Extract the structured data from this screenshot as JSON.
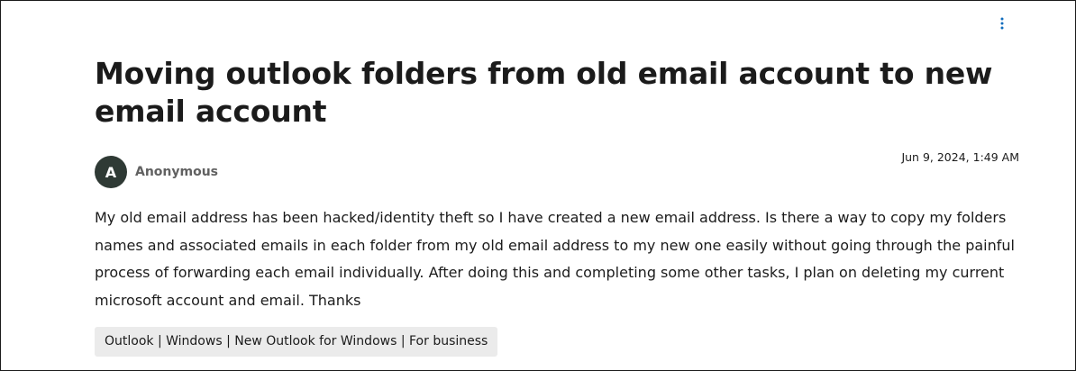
{
  "question": {
    "title": "Moving outlook folders from old email account to new email account",
    "author": {
      "initial": "A",
      "name": "Anonymous"
    },
    "timestamp": "Jun 9, 2024, 1:49 AM",
    "body": "My old email address has been hacked/identity theft so I have created a new email address. Is there a way to copy my folders names and associated emails in each folder from my old email address to my new one easily without going through the painful process of forwarding each email individually. After doing this and completing some other tasks, I plan on deleting my current microsoft account and email. Thanks",
    "tags": "Outlook | Windows | New Outlook for Windows | For business"
  },
  "actions": {
    "more_icon": "more-vertical-icon",
    "accent_color": "#0f6cbd"
  },
  "avatar_color": "#2f3a35"
}
